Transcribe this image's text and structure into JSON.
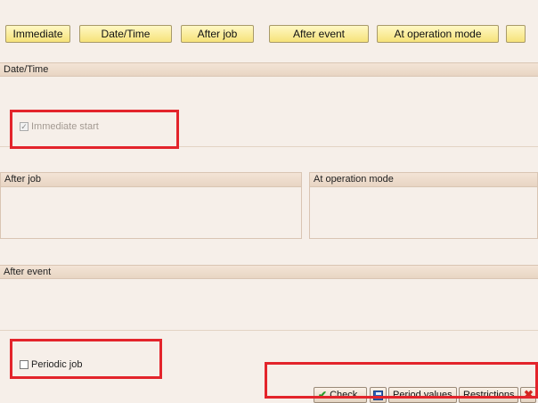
{
  "toolbar": {
    "immediate": "Immediate",
    "datetime": "Date/Time",
    "after_job": "After job",
    "after_event": "After event",
    "at_operation_mode": "At operation mode"
  },
  "sections": {
    "datetime_title": "Date/Time",
    "after_job_title": "After job",
    "at_operation_mode_title": "At operation mode",
    "after_event_title": "After event"
  },
  "fields": {
    "immediate_start_label": "Immediate start",
    "immediate_start_checked": true,
    "periodic_job_label": "Periodic job",
    "periodic_job_checked": false
  },
  "footer": {
    "check_label": "Check",
    "period_values_label": "Period values",
    "restrictions_label": "Restrictions"
  },
  "icons": {
    "check": "check-icon",
    "save": "save-icon",
    "cancel": "cancel-icon"
  },
  "colors": {
    "background": "#f6efe9",
    "toolbar_button": "#f6e27a",
    "highlight": "#e3242b"
  }
}
